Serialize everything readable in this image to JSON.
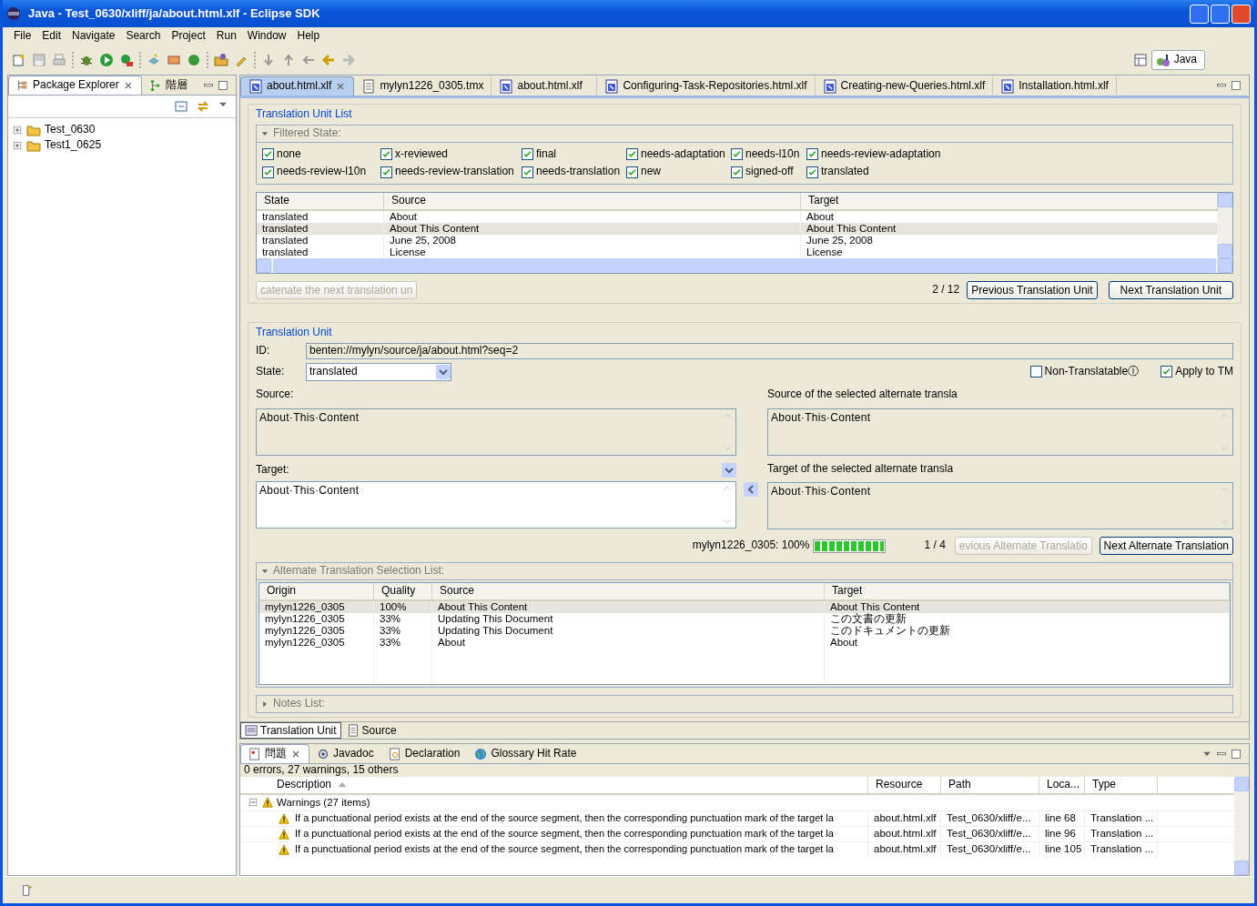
{
  "window": {
    "title": "Java - Test_0630/xliff/ja/about.html.xlf - Eclipse SDK"
  },
  "menu": [
    "File",
    "Edit",
    "Navigate",
    "Search",
    "Project",
    "Run",
    "Window",
    "Help"
  ],
  "perspective": {
    "label": "Java"
  },
  "explorer": {
    "tabs": [
      {
        "label": "Package Explorer",
        "selected": true
      },
      {
        "label": "階層",
        "selected": false
      }
    ],
    "tree": [
      {
        "label": "Test_0630",
        "expanded": false
      },
      {
        "label": "Test1_0625",
        "expanded": false
      }
    ]
  },
  "editor": {
    "tabs": [
      {
        "label": "about.html.xlf",
        "kind": "xlf",
        "selected": true
      },
      {
        "label": "mylyn1226_0305.tmx",
        "kind": "tmx",
        "selected": false
      },
      {
        "label": "about.html.xlf",
        "kind": "xlf",
        "selected": false
      },
      {
        "label": "Configuring-Task-Repositories.html.xlf",
        "kind": "xlf",
        "selected": false
      },
      {
        "label": "Creating-new-Queries.html.xlf",
        "kind": "xlf",
        "selected": false
      },
      {
        "label": "Installation.html.xlf",
        "kind": "xlf",
        "selected": false
      }
    ],
    "bottom_tabs": [
      {
        "label": "Translation Unit",
        "selected": true
      },
      {
        "label": "Source",
        "selected": false
      }
    ]
  },
  "unit_list": {
    "title": "Translation Unit List",
    "filter": {
      "title": "Filtered State:",
      "expanded": true,
      "states": [
        {
          "label": "none",
          "checked": true
        },
        {
          "label": "x-reviewed",
          "checked": true
        },
        {
          "label": "final",
          "checked": true
        },
        {
          "label": "needs-adaptation",
          "checked": true
        },
        {
          "label": "needs-l10n",
          "checked": true
        },
        {
          "label": "needs-review-adaptation",
          "checked": true
        },
        {
          "label": "needs-review-l10n",
          "checked": true
        },
        {
          "label": "needs-review-translation",
          "checked": true
        },
        {
          "label": "needs-translation",
          "checked": true
        },
        {
          "label": "new",
          "checked": true
        },
        {
          "label": "signed-off",
          "checked": true
        },
        {
          "label": "translated",
          "checked": true
        }
      ]
    },
    "table": {
      "columns": [
        "State",
        "Source",
        "Target"
      ],
      "rows": [
        {
          "cells": [
            "translated",
            "About",
            "About"
          ],
          "selected": false
        },
        {
          "cells": [
            "translated",
            "About This Content",
            "About This Content"
          ],
          "selected": true
        },
        {
          "cells": [
            "translated",
            "June 25, 2008",
            "June 25, 2008"
          ],
          "selected": false
        },
        {
          "cells": [
            "translated",
            "License",
            "License"
          ],
          "selected": false
        }
      ]
    },
    "concat_button": {
      "label": "catenate the next translation un",
      "disabled": true
    },
    "counter": "2 / 12",
    "previous_button": {
      "label": "Previous Translation Unit",
      "disabled": false
    },
    "next_button": {
      "label": "Next Translation Unit",
      "disabled": false
    }
  },
  "unit": {
    "title": "Translation Unit",
    "id_label": "ID:",
    "id": "benten://mylyn/source/ja/about.html?seq=2",
    "state_label": "State:",
    "state": "translated",
    "non_translatable": {
      "label": "Non-TranslatableⒾ",
      "checked": false
    },
    "apply_tm": {
      "label": "Apply to TM",
      "checked": true
    },
    "source_label": "Source:",
    "source": "About·This·Content",
    "alt_source_label": "Source of the selected alternate transla",
    "alt_source": "About·This·Content",
    "target_label": "Target:",
    "target": "About·This·Content",
    "alt_target_label": "Target of the selected alternate transla",
    "alt_target": "About·This·Content",
    "match_label": "mylyn1226_0305: 100%",
    "match": {
      "level": 1
    },
    "alt_counter": "1 / 4",
    "previous_alt_button": {
      "label": "evious Alternate Translatio",
      "disabled": true
    },
    "next_alt_button": {
      "label": "Next Alternate Translation",
      "disabled": false
    }
  },
  "alternates": {
    "title": "Alternate Translation Selection List:",
    "expanded": true,
    "columns": [
      "Origin",
      "Quality",
      "Source",
      "Target"
    ],
    "rows": [
      {
        "cells": [
          "mylyn1226_0305",
          "100%",
          "About This Content",
          "About This Content"
        ],
        "selected": true
      },
      {
        "cells": [
          "mylyn1226_0305",
          "33%",
          "Updating This Document",
          "この文書の更新"
        ],
        "selected": false
      },
      {
        "cells": [
          "mylyn1226_0305",
          "33%",
          "Updating This Document",
          "このドキュメントの更新"
        ],
        "selected": false
      },
      {
        "cells": [
          "mylyn1226_0305",
          "33%",
          "About",
          "About"
        ],
        "selected": false
      }
    ]
  },
  "notes": {
    "title": "Notes List:",
    "expanded": false
  },
  "problems": {
    "tabs": [
      {
        "label": "問題",
        "selected": true
      },
      {
        "label": "Javadoc",
        "selected": false
      },
      {
        "label": "Declaration",
        "selected": false
      },
      {
        "label": "Glossary Hit Rate",
        "selected": false
      }
    ],
    "summary": "0 errors, 27 warnings, 15 others",
    "columns": [
      "Description",
      "Resource",
      "Path",
      "Loca...",
      "Type"
    ],
    "group": {
      "label": "Warnings (27 items)",
      "expanded": true
    },
    "rows": [
      {
        "cells": [
          "If a punctuational period exists at the end of the source segment, then the corresponding punctuation mark of the target la",
          "about.html.xlf",
          "Test_0630/xliff/e...",
          "line 68",
          "Translation ..."
        ]
      },
      {
        "cells": [
          "If a punctuational period exists at the end of the source segment, then the corresponding punctuation mark of the target la",
          "about.html.xlf",
          "Test_0630/xliff/e...",
          "line 96",
          "Translation ..."
        ]
      },
      {
        "cells": [
          "If a punctuational period exists at the end of the source segment, then the corresponding punctuation mark of the target la",
          "about.html.xlf",
          "Test_0630/xliff/e...",
          "line 105",
          "Translation ..."
        ]
      }
    ]
  }
}
